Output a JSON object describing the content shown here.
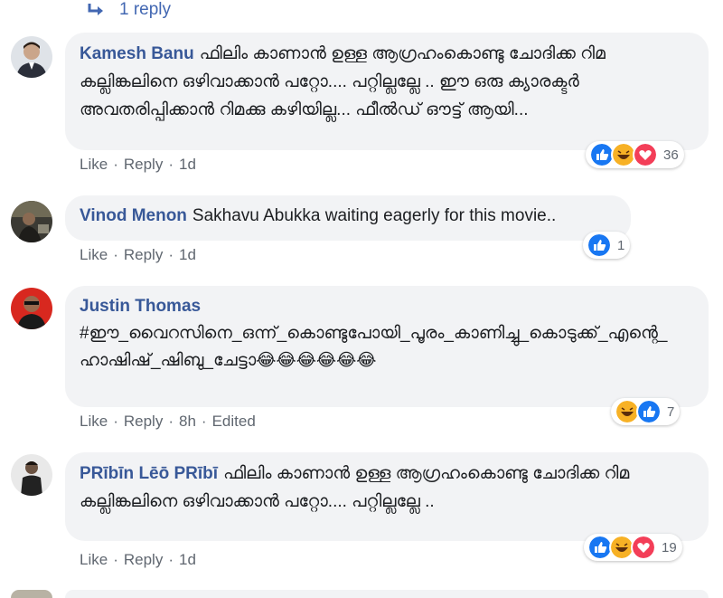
{
  "replies": {
    "label": "1 reply"
  },
  "comments": [
    {
      "author": "Kamesh Banu",
      "text": "ഫിലിം കാണാൻ ഉള്ള ആഗ്രഹംകൊണ്ടു ചോദിക്ക റിമ കല്ലിങ്കലിനെ ഒഴിവാക്കാൻ പറ്റോ.... പറ്റില്ലല്ലേ .. ഈ ഒരു ക്യാരക്ടർ അവതരിപ്പിക്കാൻ റിമക്കു കഴിയില്ല... ഫീൽഡ് ഔട്ട് ആയി...",
      "like": "Like",
      "reply": "Reply",
      "time": "1d",
      "edited": "",
      "reactions": [
        "like",
        "haha",
        "love"
      ],
      "count": "36"
    },
    {
      "author": "Vinod Menon",
      "text": "Sakhavu Abukka waiting eagerly for this movie..",
      "like": "Like",
      "reply": "Reply",
      "time": "1d",
      "edited": "",
      "reactions": [
        "like"
      ],
      "count": "1"
    },
    {
      "author": "Justin Thomas",
      "text": "#ഈ_വൈറസിനെ_ഒന്ന്_കൊണ്ടുപോയി_പൂരം_കാണിച്ചു_കൊടുക്ക്_എന്റെ_ഹാഷിഷ്_ഷിബു_ചേട്ടാ😂😂😂😂😂😂",
      "like": "Like",
      "reply": "Reply",
      "time": "8h",
      "edited": "Edited",
      "reactions": [
        "haha",
        "like"
      ],
      "count": "7"
    },
    {
      "author": "PRībīn Lēō PRībī",
      "text": "ഫിലിം കാണാൻ ഉള്ള ആഗ്രഹംകൊണ്ടു ചോദിക്ക റിമ കല്ലിങ്കലിനെ ഒഴിവാക്കാൻ പറ്റോ.... പറ്റില്ലല്ലേ ..",
      "like": "Like",
      "reply": "Reply",
      "time": "1d",
      "edited": "",
      "reactions": [
        "like",
        "haha",
        "love"
      ],
      "count": "19"
    }
  ],
  "colors": {
    "link": "#385898",
    "bubble": "#f2f3f5",
    "meta": "#606770",
    "like": "#1877f2",
    "love": "#f33e58",
    "haha": "#f7b125"
  }
}
